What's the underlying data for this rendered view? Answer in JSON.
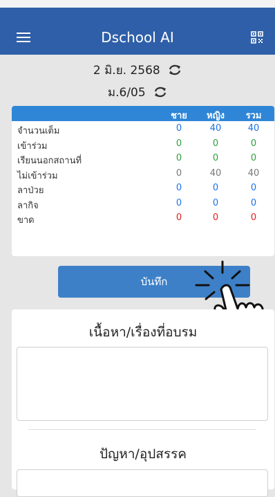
{
  "header": {
    "title": "Dschool AI",
    "menu_icon": "hamburger-icon",
    "qr_icon": "qr-code-icon"
  },
  "session": {
    "date": "2 มิ.ย. 2568",
    "class": "ม.6/05",
    "refresh_icon": "refresh-icon"
  },
  "attendance": {
    "columns": [
      "ชาย",
      "หญิง",
      "รวม"
    ],
    "rows": [
      {
        "label": "จำนวนเต็ม",
        "male": "0",
        "female": "40",
        "total": "40",
        "color": "#1a73e8"
      },
      {
        "label": "เข้าร่วม",
        "male": "0",
        "female": "0",
        "total": "0",
        "color": "#2e9e3e"
      },
      {
        "label": "เรียนนอกสถานที่",
        "male": "0",
        "female": "0",
        "total": "0",
        "color": "#2e9e3e"
      },
      {
        "label": "ไม่เข้าร่วม",
        "male": "0",
        "female": "40",
        "total": "40",
        "color": "#777777"
      },
      {
        "label": "ลาป่วย",
        "male": "0",
        "female": "0",
        "total": "0",
        "color": "#1a73e8"
      },
      {
        "label": "ลากิจ",
        "male": "0",
        "female": "0",
        "total": "0",
        "color": "#1a73e8"
      },
      {
        "label": "ขาด",
        "male": "0",
        "female": "0",
        "total": "0",
        "color": "#e02020"
      }
    ]
  },
  "actions": {
    "save_label": "บันทึก"
  },
  "form": {
    "content_title": "เนื้อหา/เรื่องที่อบรม",
    "problem_title": "ปัญหา/อุปสรรค"
  },
  "colors": {
    "header_bg": "#2f5fa8",
    "table_header_bg": "#2f86d6",
    "button_bg": "#3d80c7"
  }
}
